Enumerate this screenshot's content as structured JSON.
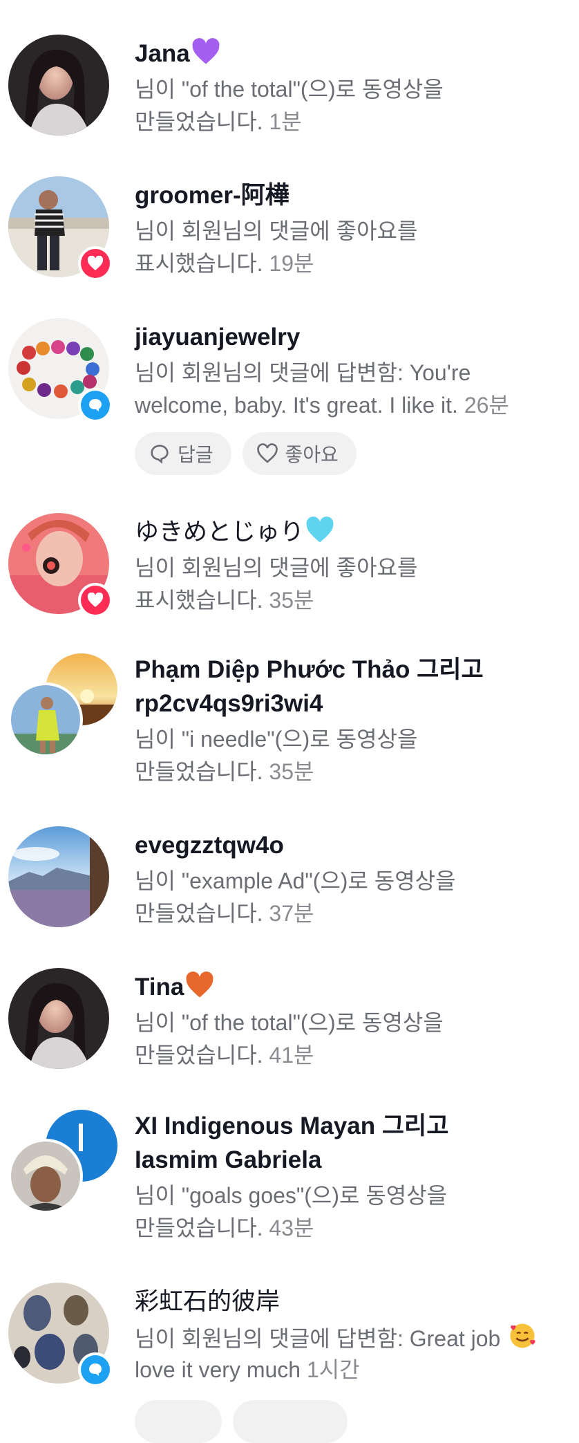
{
  "notifications": [
    {
      "name": "Jana",
      "name_emoji": "purple-heart",
      "line1": "님이 \"of the total\"(으)로 동영상을",
      "line2": "만들었습니다.",
      "time": "1분"
    },
    {
      "name": "groomer-阿樺",
      "line1": "님이 회원님의 댓글에 좋아요를",
      "line2": "표시했습니다.",
      "time": "19분",
      "badge": "heart-icon"
    },
    {
      "name": "jiayuanjewelry",
      "line1": "님이 회원님의 댓글에 답변함: You're",
      "line2": "welcome, baby. It's great. I like it.",
      "time": "26분",
      "badge": "reply-icon",
      "reply_label": "답글",
      "like_label": "좋아요"
    },
    {
      "name": "ゆきめとじゅり",
      "name_emoji": "light-blue-heart",
      "line1": "님이 회원님의 댓글에 좋아요를",
      "line2": "표시했습니다.",
      "time": "35분",
      "badge": "heart-icon"
    },
    {
      "name_line1": "Phạm Diệp Phước Thảo 그리고",
      "name_line2": "rp2cv4qs9ri3wi4",
      "line1": "님이 \"i needle\"(으)로 동영상을",
      "line2": "만들었습니다.",
      "time": "35분"
    },
    {
      "name": "evegzztqw4o",
      "line1": "님이 \"example Ad\"(으)로 동영상을",
      "line2": "만들었습니다.",
      "time": "37분"
    },
    {
      "name": "Tina",
      "name_emoji": "orange-heart",
      "line1": "님이 \"of the total\"(으)로 동영상을",
      "line2": "만들었습니다.",
      "time": "41분"
    },
    {
      "name_line1": "XI Indigenous Mayan 그리고",
      "name_line2": "Iasmim Gabriela",
      "line1": "님이 \"goals goes\"(으)로 동영상을",
      "line2": "만들었습니다.",
      "time": "43분"
    },
    {
      "name": "彩虹石的彼岸",
      "line1": "님이 회원님의 댓글에 답변함: Great job",
      "line2": "love it very much",
      "time": "1시간",
      "badge": "reply-icon",
      "line1_emoji": "smiling-face-with-hearts"
    }
  ],
  "colors": {
    "like": "#fe2c55",
    "reply": "#1da1f2",
    "secondary_text": "#6b6d74"
  }
}
